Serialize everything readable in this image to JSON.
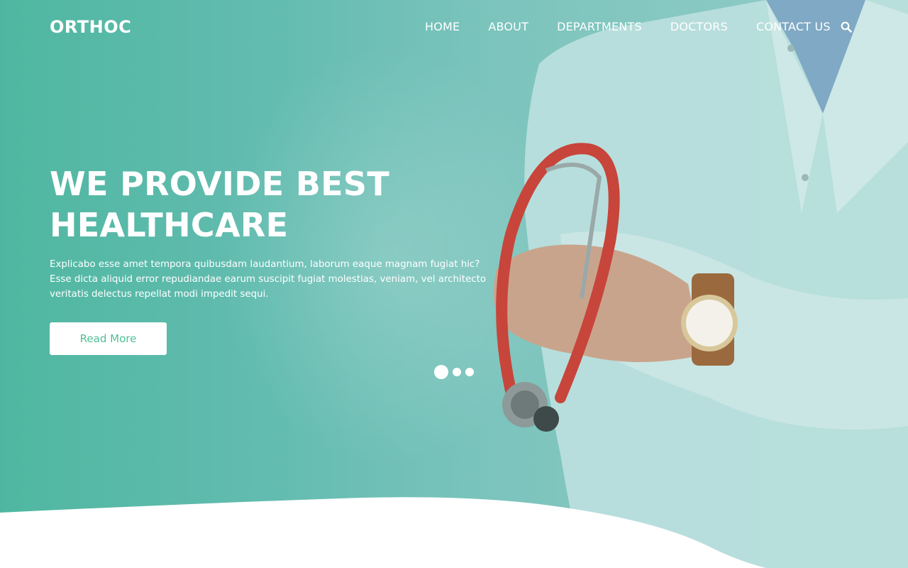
{
  "navbar": {
    "brand": "ORTHOC",
    "links": [
      "HOME",
      "ABOUT",
      "DEPARTMENTS",
      "DOCTORS",
      "CONTACT US"
    ],
    "search_icon": "search-icon"
  },
  "hero": {
    "title_line1": "WE PROVIDE BEST",
    "title_line2": "HEALTHCARE",
    "description": "Explicabo esse amet tempora quibusdam laudantium, laborum eaque magnam fugiat hic? Esse dicta aliquid error repudiandae earum suscipit fugiat molestias, veniam, vel architecto veritatis delectus repellat modi impedit sequi.",
    "button_label": "Read More"
  },
  "carousel": {
    "slide_count": 3,
    "active_index": 0
  },
  "colors": {
    "accent": "#4fbf95",
    "hero_teal": "#5fbaa8",
    "white": "#ffffff"
  }
}
